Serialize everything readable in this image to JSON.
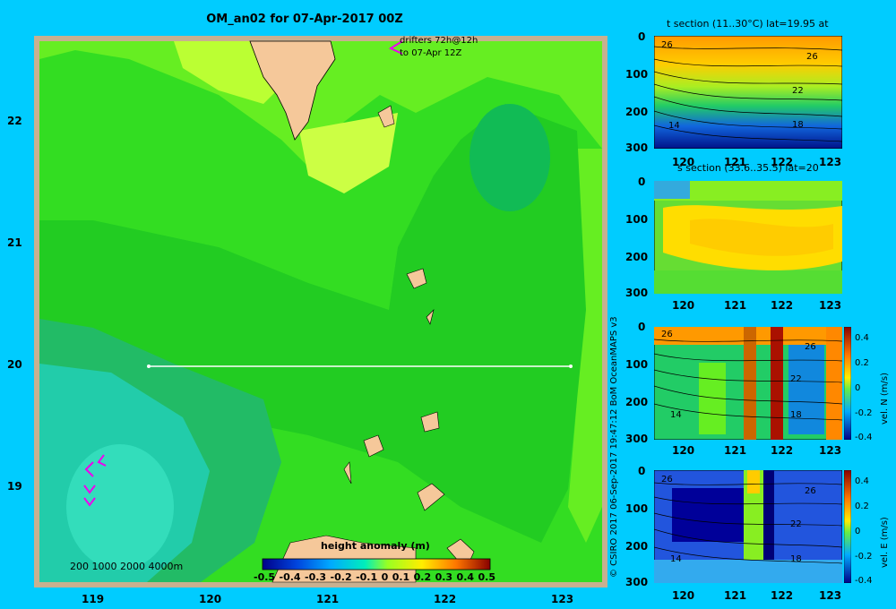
{
  "main_title": "OM_an02 for 07-Apr-2017 00Z",
  "map": {
    "lat_ticks": [
      "22",
      "21",
      "20",
      "19"
    ],
    "lon_ticks": [
      "119",
      "120",
      "121",
      "122",
      "123"
    ],
    "drifters_line1": "drifters 72h@12h",
    "drifters_line2": "to 07-Apr 12Z",
    "depth_legend": "200  1000  2000  4000m",
    "colorbar_title": "height anomaly  (m)",
    "colorbar_ticks": [
      "-0.5",
      "-0.4",
      "-0.3",
      "-0.2",
      "-0.1",
      "0",
      "0.1",
      "0.2",
      "0.3",
      "0.4",
      "0.5"
    ]
  },
  "panels": {
    "t_section": {
      "title": "t section (11..30°C) lat=19.95 at",
      "y_ticks": [
        "0",
        "100",
        "200",
        "300"
      ],
      "x_ticks": [
        "120",
        "121",
        "122",
        "123"
      ],
      "contours": [
        "26",
        "26",
        "22",
        "18",
        "14"
      ]
    },
    "s_section": {
      "title": "s section (33.6..35.5) lat=20",
      "y_ticks": [
        "0",
        "100",
        "200",
        "300"
      ],
      "x_ticks": [
        "120",
        "121",
        "122",
        "123"
      ]
    },
    "vel_n": {
      "y_ticks": [
        "0",
        "100",
        "200",
        "300"
      ],
      "x_ticks": [
        "120",
        "121",
        "122",
        "123"
      ],
      "contours": [
        "26",
        "26",
        "22",
        "18",
        "14"
      ],
      "cbar_ticks": [
        "0.4",
        "0.2",
        "0",
        "-0.2",
        "-0.4"
      ],
      "cbar_label": "vel. N  (m/s)"
    },
    "vel_e": {
      "y_ticks": [
        "0",
        "100",
        "200",
        "300"
      ],
      "x_ticks": [
        "120",
        "121",
        "122",
        "123"
      ],
      "contours": [
        "26",
        "26",
        "22",
        "18",
        "14"
      ],
      "cbar_ticks": [
        "0.4",
        "0.2",
        "0",
        "-0.2",
        "-0.4"
      ],
      "cbar_label": "vel. E  (m/s)"
    }
  },
  "credit": "© CSIRO 2017   06-Sep-2017 19:47:12 BoM OceanMAPS v3",
  "colors": {
    "background": "#00ccff",
    "land": "#f5c89a",
    "frame": "#c8b090"
  }
}
